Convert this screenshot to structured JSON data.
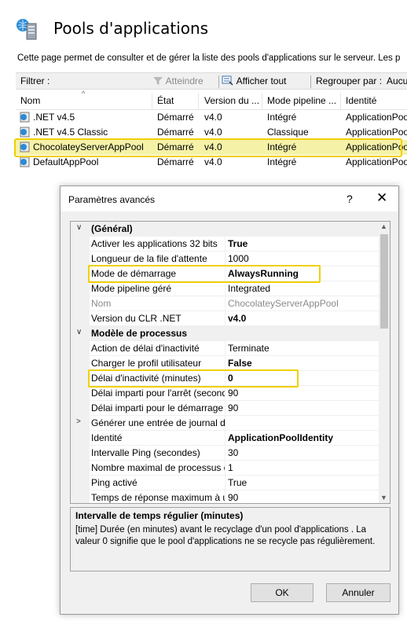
{
  "page": {
    "title": "Pools d'applications",
    "description": "Cette page permet de consulter et de gérer la liste des pools d'applications sur le serveur. Les p"
  },
  "filterbar": {
    "filter_label": "Filtrer :",
    "start_label": "Atteindre",
    "show_all_label": "Afficher tout",
    "group_by_label": "Regrouper par :",
    "group_by_value": "Aucun re"
  },
  "list": {
    "columns": [
      "Nom",
      "État",
      "Version du ...",
      "Mode pipeline ...",
      "Identité"
    ],
    "rows": [
      {
        "name": ".NET v4.5",
        "state": "Démarré",
        "version": "v4.0",
        "pipeline": "Intégré",
        "identity": "ApplicationPoo"
      },
      {
        "name": ".NET v4.5 Classic",
        "state": "Démarré",
        "version": "v4.0",
        "pipeline": "Classique",
        "identity": "ApplicationPoo"
      },
      {
        "name": "ChocolateyServerAppPool",
        "state": "Démarré",
        "version": "v4.0",
        "pipeline": "Intégré",
        "identity": "ApplicationPoo"
      },
      {
        "name": "DefaultAppPool",
        "state": "Démarré",
        "version": "v4.0",
        "pipeline": "Intégré",
        "identity": "ApplicationPoo"
      }
    ]
  },
  "dialog": {
    "title": "Paramètres avancés",
    "help": "?",
    "close": "✕",
    "properties": [
      {
        "name": "(Général)",
        "value": "",
        "category": true,
        "expanded": true
      },
      {
        "name": "Activer les applications 32 bits",
        "value": "True",
        "bold": true
      },
      {
        "name": "Longueur de la file d'attente",
        "value": "1000"
      },
      {
        "name": "Mode de démarrage",
        "value": "AlwaysRunning",
        "bold": true
      },
      {
        "name": "Mode pipeline géré",
        "value": "Integrated"
      },
      {
        "name": "Nom",
        "value": "ChocolateyServerAppPool",
        "disabled": true
      },
      {
        "name": "Version du CLR .NET",
        "value": "v4.0",
        "bold": true
      },
      {
        "name": "Modèle de processus",
        "value": "",
        "category": true,
        "expanded": true
      },
      {
        "name": "Action de délai d'inactivité",
        "value": "Terminate"
      },
      {
        "name": "Charger le profil utilisateur",
        "value": "False",
        "bold": true
      },
      {
        "name": "Délai d'inactivité (minutes)",
        "value": "0",
        "bold": true
      },
      {
        "name": "Délai imparti pour l'arrêt (secondes)",
        "value": "90"
      },
      {
        "name": "Délai imparti pour le démarrage",
        "value": "90"
      },
      {
        "name": "Générer une entrée de journal de",
        "value": "",
        "collapsed": true
      },
      {
        "name": "Identité",
        "value": "ApplicationPoolIdentity",
        "bold": true
      },
      {
        "name": "Intervalle Ping (secondes)",
        "value": "30"
      },
      {
        "name": "Nombre maximal de processus de",
        "value": "1"
      },
      {
        "name": "Ping activé",
        "value": "True"
      },
      {
        "name": "Temps de réponse maximum à un",
        "value": "90"
      }
    ],
    "description_title": "Intervalle de temps régulier (minutes)",
    "description_text": "[time] Durée (en minutes) avant le recyclage d'un pool d'applications . La valeur 0 signifie que le pool d'applications ne se recycle pas régulièrement.",
    "ok_label": "OK",
    "cancel_label": "Annuler"
  },
  "colors": {
    "highlight": "#f0d000",
    "selection": "#f5f2a8"
  }
}
